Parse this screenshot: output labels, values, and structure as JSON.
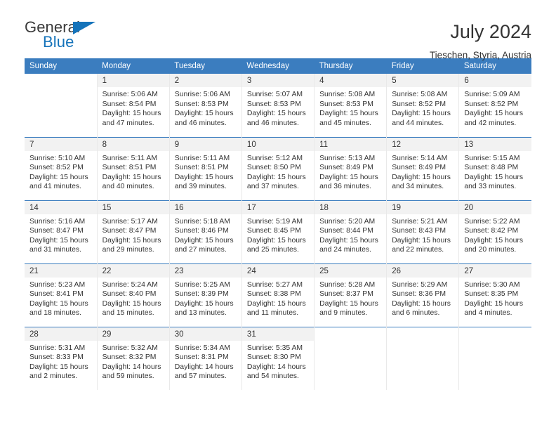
{
  "brand": {
    "name_dark": "General",
    "name_blue": "Blue",
    "accent_color": "#1573ba"
  },
  "header": {
    "title": "July 2024",
    "subtitle": "Tieschen, Styria, Austria"
  },
  "calendar": {
    "header_bg": "#3b7dbf",
    "daynum_bg": "#f2f2f2",
    "weekday_headers": [
      "Sunday",
      "Monday",
      "Tuesday",
      "Wednesday",
      "Thursday",
      "Friday",
      "Saturday"
    ],
    "weeks": [
      [
        {
          "day": "",
          "lines": []
        },
        {
          "day": "1",
          "lines": [
            "Sunrise: 5:06 AM",
            "Sunset: 8:54 PM",
            "Daylight: 15 hours",
            "and 47 minutes."
          ]
        },
        {
          "day": "2",
          "lines": [
            "Sunrise: 5:06 AM",
            "Sunset: 8:53 PM",
            "Daylight: 15 hours",
            "and 46 minutes."
          ]
        },
        {
          "day": "3",
          "lines": [
            "Sunrise: 5:07 AM",
            "Sunset: 8:53 PM",
            "Daylight: 15 hours",
            "and 46 minutes."
          ]
        },
        {
          "day": "4",
          "lines": [
            "Sunrise: 5:08 AM",
            "Sunset: 8:53 PM",
            "Daylight: 15 hours",
            "and 45 minutes."
          ]
        },
        {
          "day": "5",
          "lines": [
            "Sunrise: 5:08 AM",
            "Sunset: 8:52 PM",
            "Daylight: 15 hours",
            "and 44 minutes."
          ]
        },
        {
          "day": "6",
          "lines": [
            "Sunrise: 5:09 AM",
            "Sunset: 8:52 PM",
            "Daylight: 15 hours",
            "and 42 minutes."
          ]
        }
      ],
      [
        {
          "day": "7",
          "lines": [
            "Sunrise: 5:10 AM",
            "Sunset: 8:52 PM",
            "Daylight: 15 hours",
            "and 41 minutes."
          ]
        },
        {
          "day": "8",
          "lines": [
            "Sunrise: 5:11 AM",
            "Sunset: 8:51 PM",
            "Daylight: 15 hours",
            "and 40 minutes."
          ]
        },
        {
          "day": "9",
          "lines": [
            "Sunrise: 5:11 AM",
            "Sunset: 8:51 PM",
            "Daylight: 15 hours",
            "and 39 minutes."
          ]
        },
        {
          "day": "10",
          "lines": [
            "Sunrise: 5:12 AM",
            "Sunset: 8:50 PM",
            "Daylight: 15 hours",
            "and 37 minutes."
          ]
        },
        {
          "day": "11",
          "lines": [
            "Sunrise: 5:13 AM",
            "Sunset: 8:49 PM",
            "Daylight: 15 hours",
            "and 36 minutes."
          ]
        },
        {
          "day": "12",
          "lines": [
            "Sunrise: 5:14 AM",
            "Sunset: 8:49 PM",
            "Daylight: 15 hours",
            "and 34 minutes."
          ]
        },
        {
          "day": "13",
          "lines": [
            "Sunrise: 5:15 AM",
            "Sunset: 8:48 PM",
            "Daylight: 15 hours",
            "and 33 minutes."
          ]
        }
      ],
      [
        {
          "day": "14",
          "lines": [
            "Sunrise: 5:16 AM",
            "Sunset: 8:47 PM",
            "Daylight: 15 hours",
            "and 31 minutes."
          ]
        },
        {
          "day": "15",
          "lines": [
            "Sunrise: 5:17 AM",
            "Sunset: 8:47 PM",
            "Daylight: 15 hours",
            "and 29 minutes."
          ]
        },
        {
          "day": "16",
          "lines": [
            "Sunrise: 5:18 AM",
            "Sunset: 8:46 PM",
            "Daylight: 15 hours",
            "and 27 minutes."
          ]
        },
        {
          "day": "17",
          "lines": [
            "Sunrise: 5:19 AM",
            "Sunset: 8:45 PM",
            "Daylight: 15 hours",
            "and 25 minutes."
          ]
        },
        {
          "day": "18",
          "lines": [
            "Sunrise: 5:20 AM",
            "Sunset: 8:44 PM",
            "Daylight: 15 hours",
            "and 24 minutes."
          ]
        },
        {
          "day": "19",
          "lines": [
            "Sunrise: 5:21 AM",
            "Sunset: 8:43 PM",
            "Daylight: 15 hours",
            "and 22 minutes."
          ]
        },
        {
          "day": "20",
          "lines": [
            "Sunrise: 5:22 AM",
            "Sunset: 8:42 PM",
            "Daylight: 15 hours",
            "and 20 minutes."
          ]
        }
      ],
      [
        {
          "day": "21",
          "lines": [
            "Sunrise: 5:23 AM",
            "Sunset: 8:41 PM",
            "Daylight: 15 hours",
            "and 18 minutes."
          ]
        },
        {
          "day": "22",
          "lines": [
            "Sunrise: 5:24 AM",
            "Sunset: 8:40 PM",
            "Daylight: 15 hours",
            "and 15 minutes."
          ]
        },
        {
          "day": "23",
          "lines": [
            "Sunrise: 5:25 AM",
            "Sunset: 8:39 PM",
            "Daylight: 15 hours",
            "and 13 minutes."
          ]
        },
        {
          "day": "24",
          "lines": [
            "Sunrise: 5:27 AM",
            "Sunset: 8:38 PM",
            "Daylight: 15 hours",
            "and 11 minutes."
          ]
        },
        {
          "day": "25",
          "lines": [
            "Sunrise: 5:28 AM",
            "Sunset: 8:37 PM",
            "Daylight: 15 hours",
            "and 9 minutes."
          ]
        },
        {
          "day": "26",
          "lines": [
            "Sunrise: 5:29 AM",
            "Sunset: 8:36 PM",
            "Daylight: 15 hours",
            "and 6 minutes."
          ]
        },
        {
          "day": "27",
          "lines": [
            "Sunrise: 5:30 AM",
            "Sunset: 8:35 PM",
            "Daylight: 15 hours",
            "and 4 minutes."
          ]
        }
      ],
      [
        {
          "day": "28",
          "lines": [
            "Sunrise: 5:31 AM",
            "Sunset: 8:33 PM",
            "Daylight: 15 hours",
            "and 2 minutes."
          ]
        },
        {
          "day": "29",
          "lines": [
            "Sunrise: 5:32 AM",
            "Sunset: 8:32 PM",
            "Daylight: 14 hours",
            "and 59 minutes."
          ]
        },
        {
          "day": "30",
          "lines": [
            "Sunrise: 5:34 AM",
            "Sunset: 8:31 PM",
            "Daylight: 14 hours",
            "and 57 minutes."
          ]
        },
        {
          "day": "31",
          "lines": [
            "Sunrise: 5:35 AM",
            "Sunset: 8:30 PM",
            "Daylight: 14 hours",
            "and 54 minutes."
          ]
        },
        {
          "day": "",
          "lines": []
        },
        {
          "day": "",
          "lines": []
        },
        {
          "day": "",
          "lines": []
        }
      ]
    ]
  }
}
